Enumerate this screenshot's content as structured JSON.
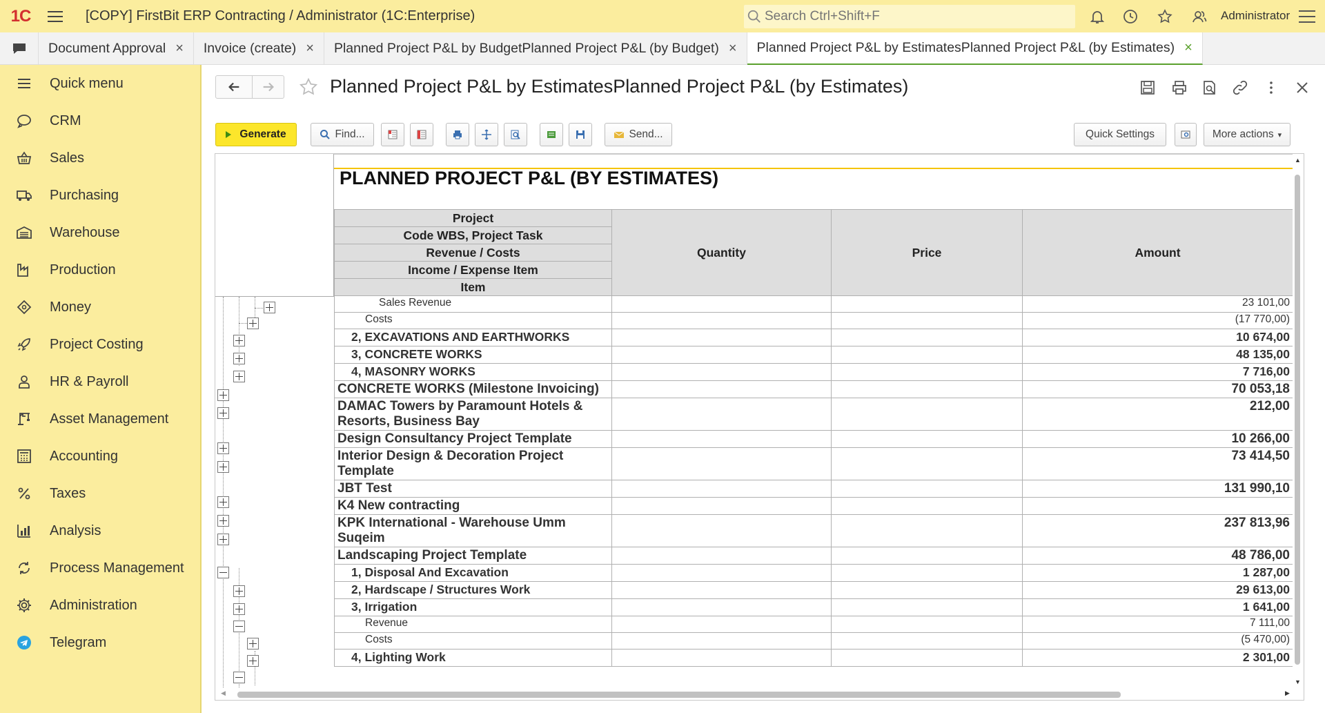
{
  "app": {
    "logo": "1C",
    "title": "[COPY] FirstBit ERP Contracting / Administrator  (1C:Enterprise)",
    "search_placeholder": "Search Ctrl+Shift+F",
    "user": "Administrator"
  },
  "tabs": [
    {
      "label": "Document Approval",
      "active": false
    },
    {
      "label": "Invoice (create)",
      "active": false
    },
    {
      "label": "Planned Project P&L by BudgetPlanned Project P&L (by Budget)",
      "active": false
    },
    {
      "label": "Planned Project P&L by EstimatesPlanned Project P&L (by Estimates)",
      "active": true
    }
  ],
  "sidebar": {
    "items": [
      {
        "label": "Quick menu",
        "icon": "menu-icon"
      },
      {
        "label": "CRM",
        "icon": "chat-icon"
      },
      {
        "label": "Sales",
        "icon": "basket-icon"
      },
      {
        "label": "Purchasing",
        "icon": "truck-icon"
      },
      {
        "label": "Warehouse",
        "icon": "warehouse-icon"
      },
      {
        "label": "Production",
        "icon": "factory-icon"
      },
      {
        "label": "Money",
        "icon": "money-icon"
      },
      {
        "label": "Project Costing",
        "icon": "rocket-icon"
      },
      {
        "label": "HR & Payroll",
        "icon": "person-icon"
      },
      {
        "label": "Asset Management",
        "icon": "crane-icon"
      },
      {
        "label": "Accounting",
        "icon": "calculator-icon"
      },
      {
        "label": "Taxes",
        "icon": "percent-icon"
      },
      {
        "label": "Analysis",
        "icon": "bar-chart-icon"
      },
      {
        "label": "Process Management",
        "icon": "cycle-icon"
      },
      {
        "label": "Administration",
        "icon": "gear-icon"
      },
      {
        "label": "Telegram",
        "icon": "telegram-icon"
      }
    ]
  },
  "page": {
    "title": "Planned Project P&L by EstimatesPlanned Project P&L (by Estimates)"
  },
  "toolbar": {
    "generate": "Generate",
    "find": "Find...",
    "send": "Send...",
    "quick_settings": "Quick Settings",
    "more_actions": "More actions"
  },
  "report": {
    "title": "PLANNED PROJECT P&L (BY ESTIMATES)",
    "headers": {
      "project": "Project",
      "wbs": "Code WBS, Project Task",
      "rev_costs": "Revenue / Costs",
      "income_item": "Income / Expense Item",
      "item": "Item",
      "quantity": "Quantity",
      "price": "Price",
      "amount": "Amount"
    },
    "rows": [
      {
        "label": "Sales Revenue",
        "amount": "23 101,00"
      },
      {
        "label": "Costs",
        "amount": "(17 770,00)"
      },
      {
        "label": "2, EXCAVATIONS AND EARTHWORKS",
        "amount": "10 674,00"
      },
      {
        "label": "3, CONCRETE WORKS",
        "amount": "48 135,00"
      },
      {
        "label": "4, MASONRY WORKS",
        "amount": "7 716,00"
      },
      {
        "label": "CONCRETE WORKS (Milestone Invoicing)",
        "amount": "70 053,18"
      },
      {
        "label": "DAMAC Towers by Paramount Hotels & Resorts, Business Bay",
        "amount": "212,00"
      },
      {
        "label": "Design Consultancy Project Template",
        "amount": "10 266,00"
      },
      {
        "label": "Interior Design & Decoration Project Template",
        "amount": "73 414,50"
      },
      {
        "label": "JBT Test",
        "amount": "131 990,10"
      },
      {
        "label": "K4 New contracting",
        "amount": ""
      },
      {
        "label": "KPK International - Warehouse Umm Suqeim",
        "amount": "237 813,96"
      },
      {
        "label": "Landscaping Project Template",
        "amount": "48 786,00"
      },
      {
        "label": "1, Disposal And Excavation",
        "amount": "1 287,00"
      },
      {
        "label": "2, Hardscape / Structures Work",
        "amount": "29 613,00"
      },
      {
        "label": "3, Irrigation",
        "amount": "1 641,00"
      },
      {
        "label": "Revenue",
        "amount": "7 111,00"
      },
      {
        "label": "Costs",
        "amount": "(5 470,00)"
      },
      {
        "label": "4, Lighting Work",
        "amount": "2 301,00"
      }
    ]
  }
}
